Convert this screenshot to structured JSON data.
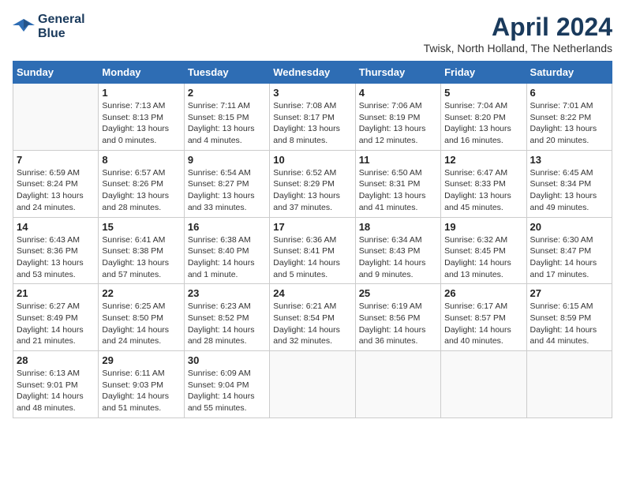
{
  "logo": {
    "line1": "General",
    "line2": "Blue"
  },
  "title": "April 2024",
  "subtitle": "Twisk, North Holland, The Netherlands",
  "days_of_week": [
    "Sunday",
    "Monday",
    "Tuesday",
    "Wednesday",
    "Thursday",
    "Friday",
    "Saturday"
  ],
  "weeks": [
    [
      {
        "day": "",
        "info": ""
      },
      {
        "day": "1",
        "info": "Sunrise: 7:13 AM\nSunset: 8:13 PM\nDaylight: 13 hours\nand 0 minutes."
      },
      {
        "day": "2",
        "info": "Sunrise: 7:11 AM\nSunset: 8:15 PM\nDaylight: 13 hours\nand 4 minutes."
      },
      {
        "day": "3",
        "info": "Sunrise: 7:08 AM\nSunset: 8:17 PM\nDaylight: 13 hours\nand 8 minutes."
      },
      {
        "day": "4",
        "info": "Sunrise: 7:06 AM\nSunset: 8:19 PM\nDaylight: 13 hours\nand 12 minutes."
      },
      {
        "day": "5",
        "info": "Sunrise: 7:04 AM\nSunset: 8:20 PM\nDaylight: 13 hours\nand 16 minutes."
      },
      {
        "day": "6",
        "info": "Sunrise: 7:01 AM\nSunset: 8:22 PM\nDaylight: 13 hours\nand 20 minutes."
      }
    ],
    [
      {
        "day": "7",
        "info": "Sunrise: 6:59 AM\nSunset: 8:24 PM\nDaylight: 13 hours\nand 24 minutes."
      },
      {
        "day": "8",
        "info": "Sunrise: 6:57 AM\nSunset: 8:26 PM\nDaylight: 13 hours\nand 28 minutes."
      },
      {
        "day": "9",
        "info": "Sunrise: 6:54 AM\nSunset: 8:27 PM\nDaylight: 13 hours\nand 33 minutes."
      },
      {
        "day": "10",
        "info": "Sunrise: 6:52 AM\nSunset: 8:29 PM\nDaylight: 13 hours\nand 37 minutes."
      },
      {
        "day": "11",
        "info": "Sunrise: 6:50 AM\nSunset: 8:31 PM\nDaylight: 13 hours\nand 41 minutes."
      },
      {
        "day": "12",
        "info": "Sunrise: 6:47 AM\nSunset: 8:33 PM\nDaylight: 13 hours\nand 45 minutes."
      },
      {
        "day": "13",
        "info": "Sunrise: 6:45 AM\nSunset: 8:34 PM\nDaylight: 13 hours\nand 49 minutes."
      }
    ],
    [
      {
        "day": "14",
        "info": "Sunrise: 6:43 AM\nSunset: 8:36 PM\nDaylight: 13 hours\nand 53 minutes."
      },
      {
        "day": "15",
        "info": "Sunrise: 6:41 AM\nSunset: 8:38 PM\nDaylight: 13 hours\nand 57 minutes."
      },
      {
        "day": "16",
        "info": "Sunrise: 6:38 AM\nSunset: 8:40 PM\nDaylight: 14 hours\nand 1 minute."
      },
      {
        "day": "17",
        "info": "Sunrise: 6:36 AM\nSunset: 8:41 PM\nDaylight: 14 hours\nand 5 minutes."
      },
      {
        "day": "18",
        "info": "Sunrise: 6:34 AM\nSunset: 8:43 PM\nDaylight: 14 hours\nand 9 minutes."
      },
      {
        "day": "19",
        "info": "Sunrise: 6:32 AM\nSunset: 8:45 PM\nDaylight: 14 hours\nand 13 minutes."
      },
      {
        "day": "20",
        "info": "Sunrise: 6:30 AM\nSunset: 8:47 PM\nDaylight: 14 hours\nand 17 minutes."
      }
    ],
    [
      {
        "day": "21",
        "info": "Sunrise: 6:27 AM\nSunset: 8:49 PM\nDaylight: 14 hours\nand 21 minutes."
      },
      {
        "day": "22",
        "info": "Sunrise: 6:25 AM\nSunset: 8:50 PM\nDaylight: 14 hours\nand 24 minutes."
      },
      {
        "day": "23",
        "info": "Sunrise: 6:23 AM\nSunset: 8:52 PM\nDaylight: 14 hours\nand 28 minutes."
      },
      {
        "day": "24",
        "info": "Sunrise: 6:21 AM\nSunset: 8:54 PM\nDaylight: 14 hours\nand 32 minutes."
      },
      {
        "day": "25",
        "info": "Sunrise: 6:19 AM\nSunset: 8:56 PM\nDaylight: 14 hours\nand 36 minutes."
      },
      {
        "day": "26",
        "info": "Sunrise: 6:17 AM\nSunset: 8:57 PM\nDaylight: 14 hours\nand 40 minutes."
      },
      {
        "day": "27",
        "info": "Sunrise: 6:15 AM\nSunset: 8:59 PM\nDaylight: 14 hours\nand 44 minutes."
      }
    ],
    [
      {
        "day": "28",
        "info": "Sunrise: 6:13 AM\nSunset: 9:01 PM\nDaylight: 14 hours\nand 48 minutes."
      },
      {
        "day": "29",
        "info": "Sunrise: 6:11 AM\nSunset: 9:03 PM\nDaylight: 14 hours\nand 51 minutes."
      },
      {
        "day": "30",
        "info": "Sunrise: 6:09 AM\nSunset: 9:04 PM\nDaylight: 14 hours\nand 55 minutes."
      },
      {
        "day": "",
        "info": ""
      },
      {
        "day": "",
        "info": ""
      },
      {
        "day": "",
        "info": ""
      },
      {
        "day": "",
        "info": ""
      }
    ]
  ]
}
